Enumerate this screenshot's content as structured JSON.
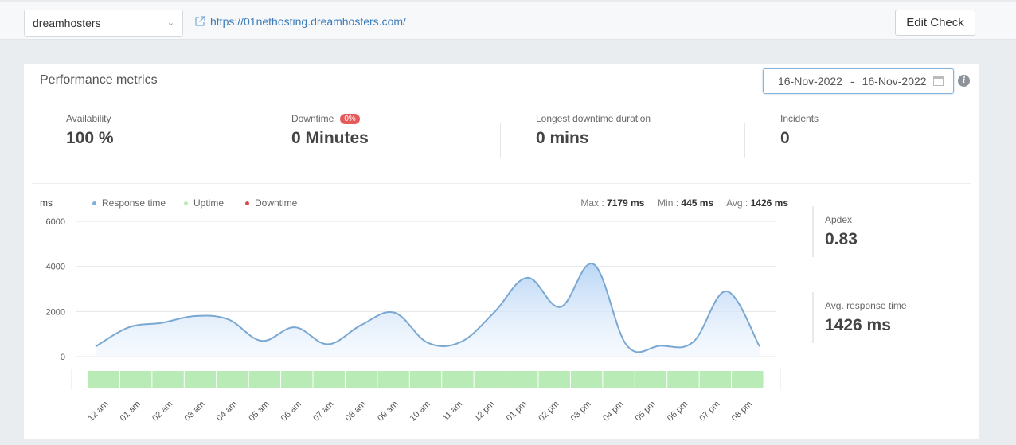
{
  "topbar": {
    "site_select": {
      "value": "dreamhosters",
      "chevron": "chevron-down-icon"
    },
    "url": "https://01nethosting.dreamhosters.com/",
    "edit_button": "Edit Check"
  },
  "card": {
    "title": "Performance metrics",
    "date_from": "16-Nov-2022",
    "date_sep": "-",
    "date_to": "16-Nov-2022",
    "info_glyph": "i"
  },
  "stats": [
    {
      "label": "Availability",
      "value": "100 %"
    },
    {
      "label": "Downtime",
      "value": "0 Minutes",
      "badge": "0%"
    },
    {
      "label": "Longest downtime duration",
      "value": "0 mins"
    },
    {
      "label": "Incidents",
      "value": "0"
    }
  ],
  "side_stats": [
    {
      "label": "Apdex",
      "value": "0.83"
    },
    {
      "label": "Avg. response time",
      "value": "1426 ms"
    }
  ],
  "summary": {
    "max_label": "Max :",
    "max_value": "7179 ms",
    "min_label": "Min :",
    "min_value": "445 ms",
    "avg_label": "Avg :",
    "avg_value": "1426 ms"
  },
  "colors": {
    "line": "#7aa8d2",
    "fill_top": "#bcd8f7",
    "uptime": "#b8ebb5",
    "downtime": "#d94a4a",
    "response": "#7fb0dc"
  },
  "chart_data": {
    "type": "area",
    "title": "",
    "ylabel": "ms",
    "xlabel": "",
    "ylim": [
      0,
      6000
    ],
    "yticks": [
      "0",
      "2000",
      "4000",
      "6000"
    ],
    "grid": true,
    "legend": [
      {
        "name": "Response time",
        "color": "#7fb0dc"
      },
      {
        "name": "Uptime",
        "color": "#b8ebb5"
      },
      {
        "name": "Downtime",
        "color": "#d94a4a"
      }
    ],
    "legend_position": "top-left",
    "categories": [
      "12 am",
      "01 am",
      "02 am",
      "03 am",
      "04 am",
      "05 am",
      "06 am",
      "07 am",
      "08 am",
      "09 am",
      "10 am",
      "11 am",
      "12 pm",
      "01 pm",
      "02 pm",
      "03 pm",
      "04 pm",
      "05 pm",
      "06 pm",
      "07 pm",
      "08 pm"
    ],
    "series": [
      {
        "name": "Response time",
        "values": [
          445,
          1300,
          1500,
          1800,
          1650,
          700,
          1300,
          550,
          1400,
          1950,
          620,
          650,
          1950,
          3500,
          2200,
          4100,
          500,
          480,
          650,
          2900,
          450
        ]
      }
    ],
    "uptime_status": [
      "up",
      "up",
      "up",
      "up",
      "up",
      "up",
      "up",
      "up",
      "up",
      "up",
      "up",
      "up",
      "up",
      "up",
      "up",
      "up",
      "up",
      "up",
      "up",
      "up",
      "up"
    ]
  }
}
